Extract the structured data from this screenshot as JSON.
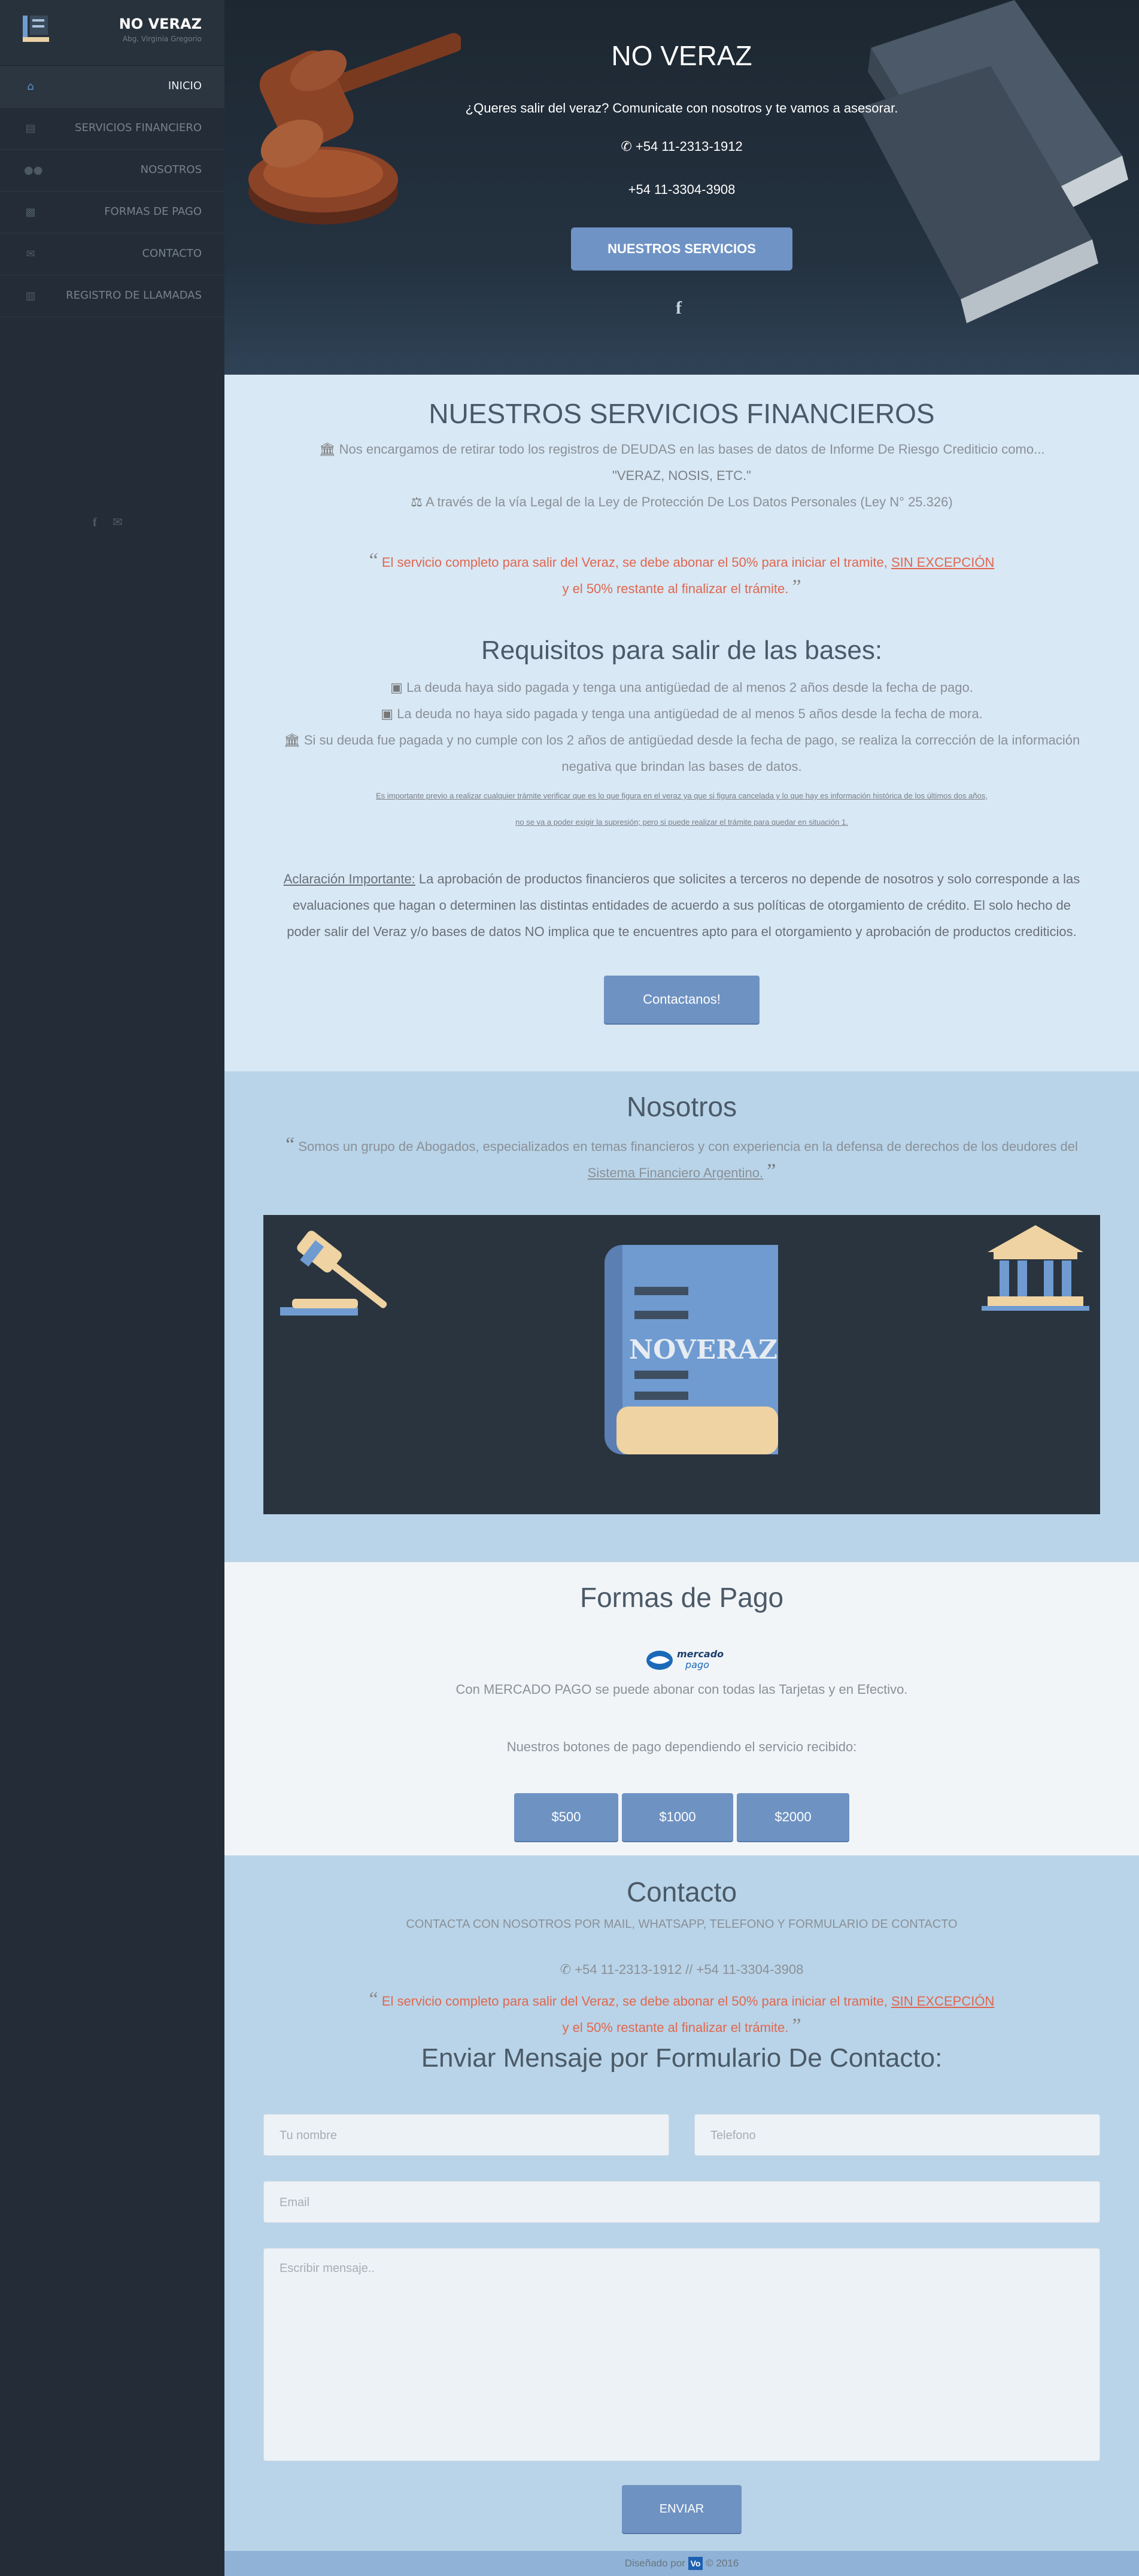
{
  "sidebar": {
    "brand_title": "NO VERAZ",
    "brand_subtitle": "Abg. Virginia Gregorio",
    "items": [
      {
        "label": "INICIO",
        "icon": "home-icon"
      },
      {
        "label": "SERVICIOS FINANCIERO",
        "icon": "document-icon"
      },
      {
        "label": "NOSOTROS",
        "icon": "users-icon"
      },
      {
        "label": "FORMAS DE PAGO",
        "icon": "money-icon"
      },
      {
        "label": "CONTACTO",
        "icon": "envelope-icon"
      },
      {
        "label": "REGISTRO DE LLAMADAS",
        "icon": "file-icon"
      }
    ],
    "social": [
      "facebook-icon",
      "envelope-icon"
    ]
  },
  "hero": {
    "title": "NO VERAZ",
    "subtitle": "¿Queres salir del veraz? Comunicate con nosotros y te vamos a asesorar.",
    "phone1": "+54 11-2313-1912",
    "phone2": "+54 11-3304-3908",
    "button": "NUESTROS SERVICIOS"
  },
  "services": {
    "title": "NUESTROS SERVICIOS FINANCIEROS",
    "line1": "Nos encargamos de retirar todo los registros de DEUDAS en las bases de datos de Informe De Riesgo Crediticio como...",
    "line2": "\"VERAZ, NOSIS, ETC.\"",
    "line3": "A través de la vía Legal de la Ley de Protección De Los Datos Personales (Ley N° 25.326)",
    "quote_a": "El servicio completo para salir del Veraz, se debe abonar el 50% para iniciar el tramite,",
    "quote_u": "SIN EXCEPCIÓN",
    "quote_b": "y el 50% restante al finalizar el trámite.",
    "req_title": "Requisitos para salir de las bases:",
    "req1": "La deuda haya sido pagada y tenga una antigüedad de al menos 2 años desde la fecha de pago.",
    "req2": "La deuda no haya sido pagada y tenga una antigüedad de al menos 5 años desde la fecha de mora.",
    "req3a": "Si su deuda fue pagada y no cumple con los 2 años de antigüedad desde la fecha de pago, se realiza la corrección de la información",
    "req3b": "negativa que brindan las bases de datos.",
    "note1": "Es importante previo a realizar cualquier trámite verificar que es lo que figura en el veraz ya que si figura cancelada y lo que hay es información histórica de los últimos dos años,",
    "note2": "no se va a poder exigir la supresión; pero si puede realizar el trámite para quedar en situación 1.",
    "clar_label": "Aclaración Importante:",
    "clar1": "La aprobación de productos financieros que solicites a terceros no depende de nosotros y solo corresponde a las",
    "clar2": "evaluaciones que hagan o determinen las distintas entidades de acuerdo a sus políticas de otorgamiento de crédito. El solo hecho de",
    "clar3": "poder salir del Veraz y/o bases de datos NO implica que te encuentres apto para el otorgamiento y aprobación de productos crediticios.",
    "button": "Contactanos!"
  },
  "about": {
    "title": "Nosotros",
    "text1": "Somos un grupo de Abogados, especializados en temas financieros y con experiencia en la defensa de derechos de los deudores del",
    "text2": "Sistema Financiero Argentino.",
    "book_text": "NOVERAZ"
  },
  "payment": {
    "title": "Formas de Pago",
    "logo_text1": "mercado",
    "logo_text2": "pago",
    "text": "Con MERCADO PAGO se puede abonar con todas las Tarjetas y en Efectivo.",
    "buttons_intro": "Nuestros botones de pago dependiendo el servicio recibido:",
    "buttons": [
      "$500",
      "$1000",
      "$2000"
    ]
  },
  "contact": {
    "title": "Contacto",
    "subtitle": "CONTACTA CON NOSOTROS POR MAIL, WHATSAPP, TELEFONO Y FORMULARIO DE CONTACTO",
    "phones": "+54 11-2313-1912 // +54 11-3304-3908",
    "quote_a": "El servicio completo para salir del Veraz, se debe abonar el 50% para iniciar el tramite,",
    "quote_u": "SIN EXCEPCIÓN",
    "quote_b": "y el 50% restante al finalizar el trámite.",
    "form_title": "Enviar Mensaje por Formulario De Contacto:",
    "name_placeholder": "Tu nombre",
    "phone_placeholder": "Telefono",
    "email_placeholder": "Email",
    "message_placeholder": "Escribir mensaje..",
    "send": "ENVIAR"
  },
  "footer": {
    "text": "Diseñado por",
    "logo": "Vo",
    "year": "© 2016"
  }
}
